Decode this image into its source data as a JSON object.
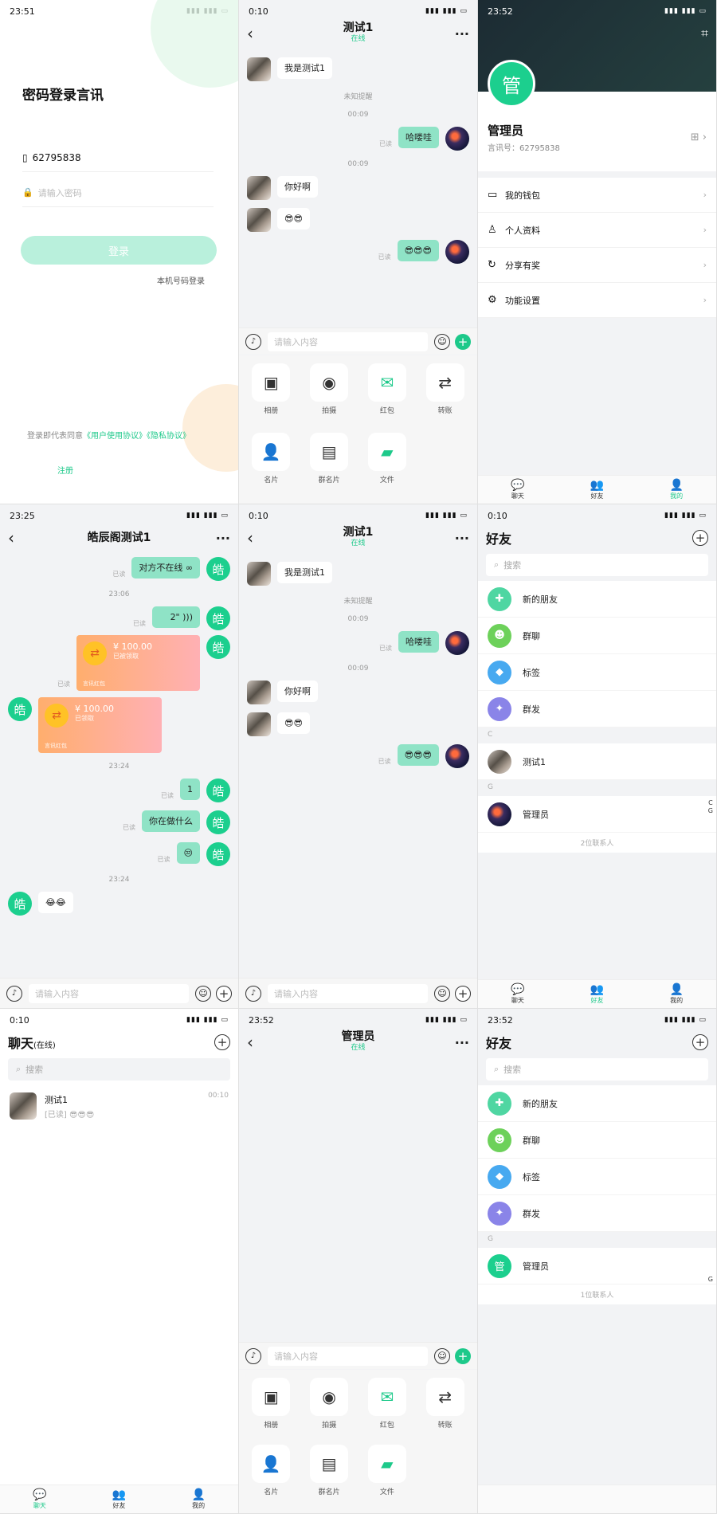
{
  "login": {
    "time": "23:51",
    "title": "密码登录言讯",
    "account": "62795838",
    "pwd_placeholder": "请输入密码",
    "login_button": "登录",
    "sms_link": "本机号码登录",
    "agree_prefix": "登录即代表同意",
    "agree_terms": "《用户使用协议》《隐私协议》",
    "register_link": "注册"
  },
  "chat1": {
    "time": "0:10",
    "title": "测试1",
    "status": "在线",
    "msgs": [
      "我是测试1",
      "未知提醒",
      "00:09",
      "哈喽哇",
      "已读",
      "00:09",
      "你好啊",
      "😎😎",
      "😎😎😎",
      "已读"
    ],
    "input_placeholder": "请输入内容",
    "tools": [
      "相册",
      "拍摄",
      "红包",
      "转账",
      "名片",
      "群名片",
      "文件"
    ]
  },
  "profile": {
    "time": "23:52",
    "avatar": "管",
    "name": "管理员",
    "id_label": "言讯号：62795838",
    "menu": [
      "我的钱包",
      "个人资料",
      "分享有奖",
      "功能设置"
    ]
  },
  "tabs": [
    "聊天",
    "好友",
    "我的"
  ],
  "hchat": {
    "time": "23:25",
    "title": "皓辰阁测试1",
    "avatar": "皓",
    "m1": "对方不在线",
    "read": "已读",
    "t1": "23:06",
    "voice": "2\"",
    "rp_amount": "¥ 100.00",
    "rp_status1": "已被领取",
    "rp_status2": "已领取",
    "rp_footer": "言讯红包",
    "t2": "23:24",
    "m2": "1",
    "m3": "你在做什么",
    "m4": "😒",
    "t3": "23:24",
    "m5": "😂😂",
    "input_placeholder": "请输入内容"
  },
  "chat2": {
    "time": "0:10",
    "title": "测试1",
    "status": "在线",
    "msgs": [
      "我是测试1",
      "未知提醒",
      "00:09",
      "哈喽哇",
      "已读",
      "00:09",
      "你好啊",
      "😎😎",
      "😎😎😎",
      "已读"
    ]
  },
  "friends1": {
    "time": "0:10",
    "title": "好友",
    "search": "搜索",
    "items": [
      "新的朋友",
      "群聊",
      "标签",
      "群发"
    ],
    "sec_c": "C",
    "contact1": "测试1",
    "sec_g": "G",
    "contact2": "管理员",
    "count": "2位联系人",
    "idx": [
      "C",
      "G"
    ]
  },
  "chatlist": {
    "time": "0:10",
    "title": "聊天",
    "sub": "(在线)",
    "search": "搜索",
    "item_name": "测试1",
    "item_msg": "[已读] 😎😎😎",
    "item_time": "00:10"
  },
  "chat3": {
    "time": "23:52",
    "title": "管理员",
    "status": "在线",
    "input_placeholder": "请输入内容",
    "tools": [
      "相册",
      "拍摄",
      "红包",
      "转账",
      "名片",
      "群名片",
      "文件"
    ]
  },
  "friends2": {
    "time": "23:52",
    "title": "好友",
    "search": "搜索",
    "items": [
      "新的朋友",
      "群聊",
      "标签",
      "群发"
    ],
    "sec_g": "G",
    "avatar": "管",
    "contact": "管理员",
    "count": "1位联系人",
    "idx": "G"
  },
  "colors": {
    "accent": "#1dc98a"
  }
}
